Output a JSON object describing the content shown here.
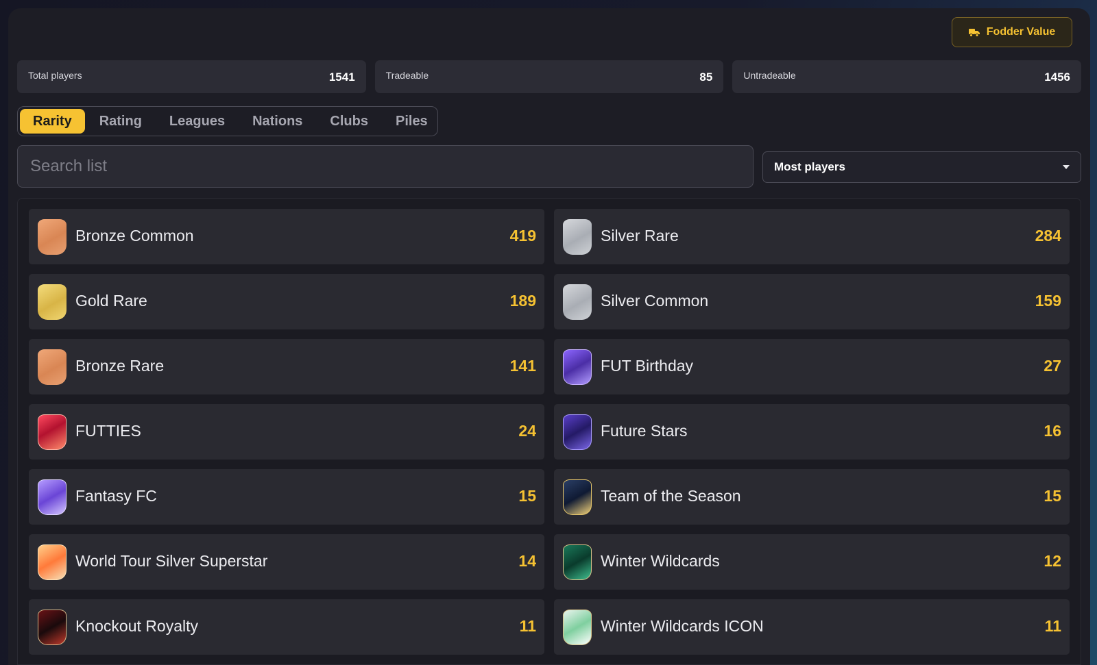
{
  "toolbar": {
    "fodder_label": "Fodder Value",
    "fodder_icon": "truck-icon"
  },
  "stats": [
    {
      "label": "Total players",
      "value": "1541"
    },
    {
      "label": "Tradeable",
      "value": "85"
    },
    {
      "label": "Untradeable",
      "value": "1456"
    }
  ],
  "tabs": [
    {
      "label": "Rarity",
      "active": true
    },
    {
      "label": "Rating"
    },
    {
      "label": "Leagues"
    },
    {
      "label": "Nations"
    },
    {
      "label": "Clubs"
    },
    {
      "label": "Piles"
    }
  ],
  "search": {
    "placeholder": "Search list",
    "value": ""
  },
  "sort": {
    "selected": "Most players"
  },
  "accent_color": "#f6c232",
  "rarities": [
    {
      "name": "Bronze Common",
      "count": "419",
      "style": "bronze"
    },
    {
      "name": "Silver Rare",
      "count": "284",
      "style": "silver"
    },
    {
      "name": "Gold Rare",
      "count": "189",
      "style": "gold"
    },
    {
      "name": "Silver Common",
      "count": "159",
      "style": "silver"
    },
    {
      "name": "Bronze Rare",
      "count": "141",
      "style": "bronze"
    },
    {
      "name": "FUT Birthday",
      "count": "27",
      "style": "purple"
    },
    {
      "name": "FUTTIES",
      "count": "24",
      "style": "futties"
    },
    {
      "name": "Future Stars",
      "count": "16",
      "style": "futurestars"
    },
    {
      "name": "Fantasy FC",
      "count": "15",
      "style": "fantasy"
    },
    {
      "name": "Team of the Season",
      "count": "15",
      "style": "tots"
    },
    {
      "name": "World Tour Silver Superstar",
      "count": "14",
      "style": "worldtour"
    },
    {
      "name": "Winter Wildcards",
      "count": "12",
      "style": "wildcards"
    },
    {
      "name": "Knockout Royalty",
      "count": "11",
      "style": "knockout"
    },
    {
      "name": "Winter Wildcards ICON",
      "count": "11",
      "style": "wildicon"
    }
  ]
}
